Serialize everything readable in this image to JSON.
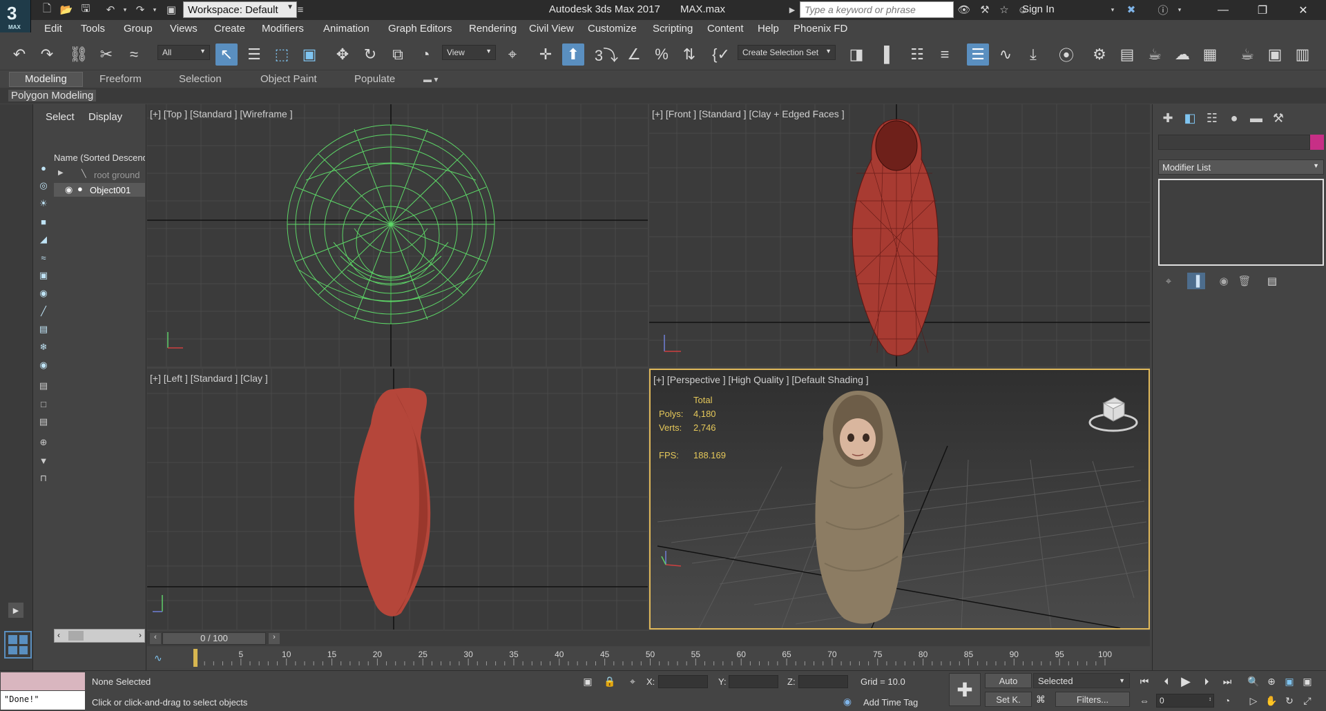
{
  "titlebar": {
    "app_logo_number": "3",
    "app_logo_text": "MAX",
    "workspace": "Workspace: Default",
    "app_title": "Autodesk 3ds Max 2017       MAX.max",
    "search_placeholder": "Type a keyword or phrase",
    "signin": "Sign In"
  },
  "menu": [
    "Edit",
    "Tools",
    "Group",
    "Views",
    "Create",
    "Modifiers",
    "Animation",
    "Graph Editors",
    "Rendering",
    "Civil View",
    "Customize",
    "Scripting",
    "Content",
    "Help",
    "Phoenix FD"
  ],
  "toolbar": {
    "filter_select": "All",
    "refcoord_select": "View",
    "selection_set": "Create Selection Set"
  },
  "ribbon": {
    "tabs": [
      "Modeling",
      "Freeform",
      "Selection",
      "Object Paint",
      "Populate"
    ],
    "active_tab": "Modeling",
    "panel_label": "Polygon Modeling"
  },
  "explorer": {
    "tabs": [
      "Select",
      "Display"
    ],
    "header": "Name (Sorted Descending)",
    "rows": [
      "root ground",
      "Object001"
    ],
    "selected": "Object001"
  },
  "viewports": {
    "top": "[+] [Top ] [Standard ] [Wireframe ]",
    "front": "[+] [Front ] [Standard ] [Clay + Edged Faces ]",
    "left": "[+] [Left ] [Standard ] [Clay ]",
    "perspective": "[+] [Perspective ] [High Quality ] [Default Shading ]"
  },
  "stats": {
    "total_label": "Total",
    "polys_label": "Polys:",
    "polys": "4,180",
    "verts_label": "Verts:",
    "verts": "2,746",
    "fps_label": "FPS:",
    "fps": "188.169"
  },
  "command_panel": {
    "modifier_list": "Modifier List",
    "object_color": "#c72f86"
  },
  "timeline": {
    "frame_display": "0 / 100",
    "ticks": [
      "0",
      "5",
      "10",
      "15",
      "20",
      "25",
      "30",
      "35",
      "40",
      "45",
      "50",
      "55",
      "60",
      "65",
      "70",
      "75",
      "80",
      "85",
      "90",
      "95",
      "100"
    ]
  },
  "status": {
    "maxscript_output": "\"Done!\"",
    "selection_status": "None Selected",
    "prompt": "Click or click-and-drag to select objects",
    "x_label": "X:",
    "y_label": "Y:",
    "z_label": "Z:",
    "grid": "Grid = 10.0",
    "add_time_tag": "Add Time Tag",
    "auto": "Auto",
    "set_key": "Set K.",
    "key_filter": "Selected",
    "filters": "Filters...",
    "current_frame": "0"
  },
  "colors": {
    "accent": "#5a8fc0",
    "wireframe": "#5fe06a",
    "clay": "#b5463a",
    "active_viewport_border": "#e1b95a"
  }
}
